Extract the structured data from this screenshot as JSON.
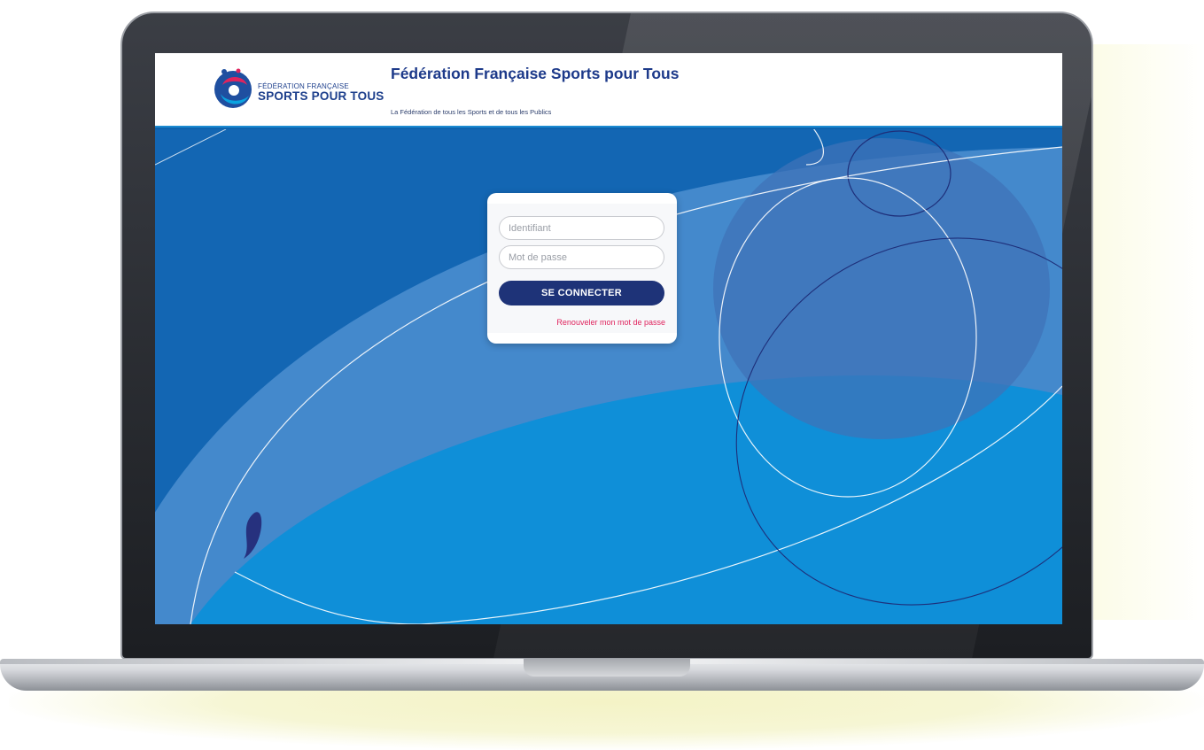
{
  "header": {
    "logo_line1": "FÉDÉRATION FRANÇAISE",
    "logo_line2": "SPORTS POUR TOUS",
    "title": "Fédération Française Sports pour Tous",
    "subtitle": "La Fédération de tous les Sports et de tous les Publics"
  },
  "login": {
    "username_placeholder": "Identifiant",
    "password_placeholder": "Mot de passe",
    "submit_label": "SE CONNECTER",
    "reset_link": "Renouveler mon mot de passe"
  },
  "colors": {
    "brand_navy": "#1e3378",
    "link_pink": "#e0245e",
    "screen_blue": "#0d63ae"
  },
  "icons": {
    "logo": "ffspt-logo-icon"
  }
}
